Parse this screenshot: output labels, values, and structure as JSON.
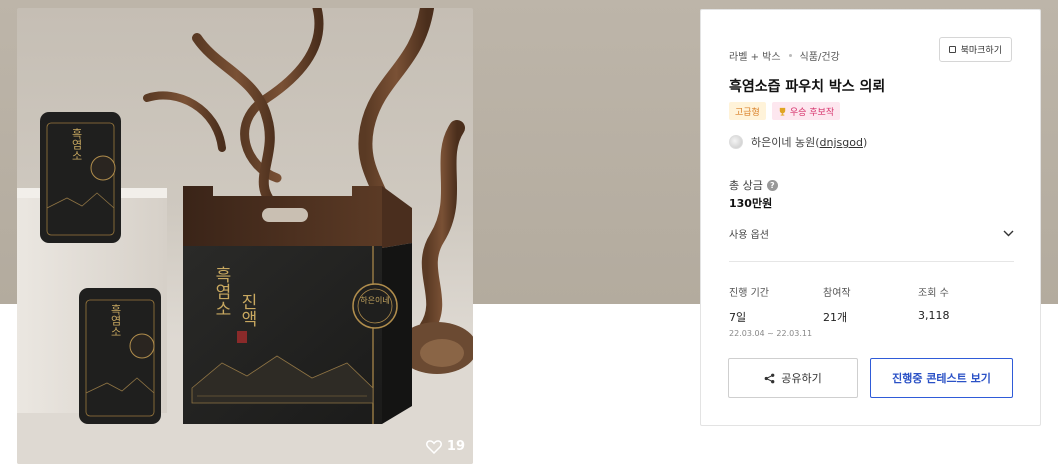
{
  "product": {
    "likes": "19",
    "box_text": {
      "name_vertical_1": "흑염소",
      "name_vertical_2": "진액",
      "seal_label": "하은이네"
    }
  },
  "card": {
    "breadcrumb": [
      "라벨 + 박스",
      "식품/건강"
    ],
    "bookmark_label": "북마크하기",
    "title": "흑염소즙 파우치 박스 의뢰",
    "badges": [
      {
        "label": "고급형",
        "color": "#d9822b"
      },
      {
        "label": "우승 후보작",
        "icon": "trophy-icon",
        "color": "#d6336c"
      }
    ],
    "designer_name": "하은이네 농원",
    "designer_handle": "dnjsgod",
    "prize_label": "총 상금",
    "prize_value": "130만원",
    "options_label": "사용 옵션",
    "stats": {
      "period_label": "진행 기간",
      "period_value": "7일",
      "period_range": "22.03.04 ~ 22.03.11",
      "entries_label": "참여작",
      "entries_value": "21개",
      "views_label": "조회 수",
      "views_value": "3,118"
    },
    "share_label": "공유하기",
    "contest_label": "진행중 콘테스트 보기",
    "accent_color": "#2f5bd8"
  }
}
